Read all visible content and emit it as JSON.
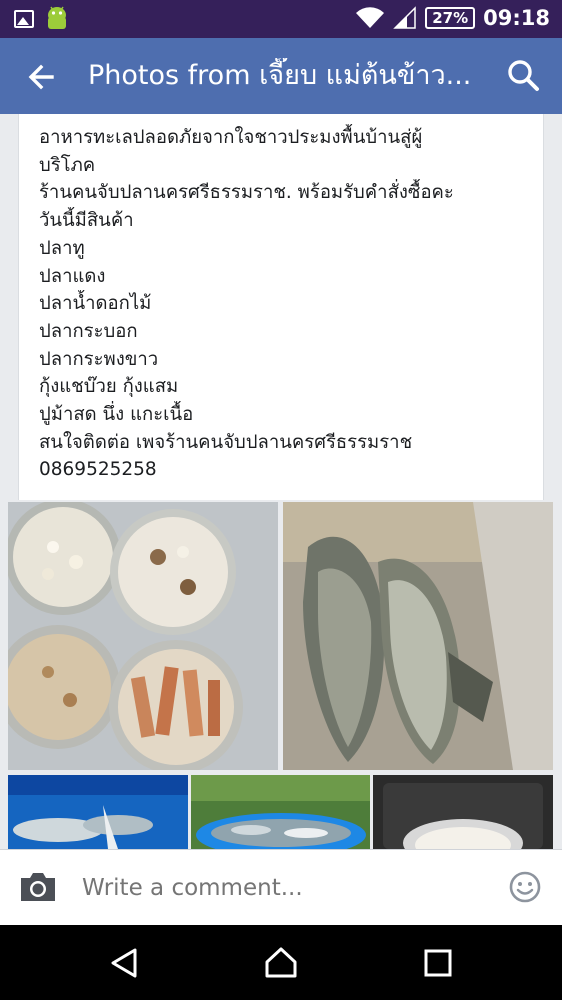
{
  "status_bar": {
    "battery": "27%",
    "time": "09:18",
    "icons": [
      "image-icon",
      "android-icon",
      "wifi-icon",
      "signal-icon",
      "battery-icon"
    ]
  },
  "app_bar": {
    "title": "Photos from เจี๊ยบ แม่ต้นข้าว...",
    "icons": [
      "back-arrow-icon",
      "search-icon"
    ]
  },
  "post": {
    "lines": [
      "อาหารทะเลปลอดภัยจากใจชาวประมงพื้นบ้านสู่ผู้",
      "บริโภค",
      "ร้านคนจับปลานครศรีธรรมราช. พร้อมรับคำสั่งซื้อคะ",
      "วันนี้มีสินค้า",
      "ปลาทู",
      "ปลาแดง",
      "ปลาน้ำดอกไม้",
      "ปลากระบอก",
      "ปลากระพงขาว",
      "กุ้งแชบ๊วย  กุ้งแสม",
      "ปูม้าสด นึ่ง แกะเนื้อ",
      "สนใจติดต่อ เพจร้านคนจับปลานครศรีธรรมราช",
      "0869525258"
    ]
  },
  "comment_bar": {
    "placeholder": "Write a comment...",
    "icons": [
      "camera-icon",
      "emoji-icon"
    ]
  },
  "nav_bar": {
    "icons": [
      "back-triangle-icon",
      "home-icon",
      "recents-icon"
    ]
  },
  "colors": {
    "status_bar": "#35205a",
    "app_bar": "#4e6eaf",
    "content_bg": "#e9ebee",
    "text": "#1c1e21",
    "placeholder": "#8d949e"
  }
}
